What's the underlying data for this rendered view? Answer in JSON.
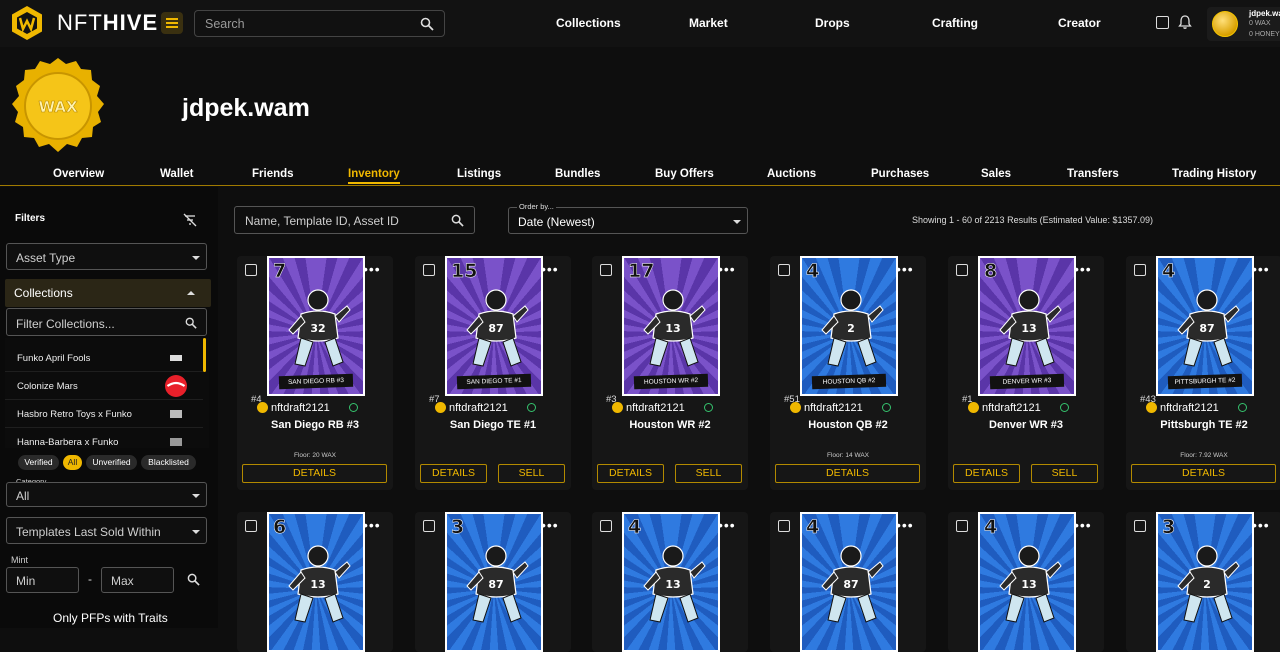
{
  "header": {
    "brand_light": "NFT",
    "brand_bold": "HIVE",
    "search_placeholder": "Search",
    "nav": [
      "Collections",
      "Market",
      "Drops",
      "Crafting",
      "Creator"
    ],
    "account": {
      "name": "jdpek.wam",
      "wax": "0 WAX",
      "honey": "0 HONEY"
    }
  },
  "profile": {
    "name": "jdpek.wam",
    "avatar_text": "WAX"
  },
  "tabs": [
    "Overview",
    "Wallet",
    "Friends",
    "Inventory",
    "Listings",
    "Bundles",
    "Buy Offers",
    "Auctions",
    "Purchases",
    "Sales",
    "Transfers",
    "Trading History"
  ],
  "active_tab": "Inventory",
  "sidebar": {
    "title": "Filters",
    "asset_type": "Asset Type",
    "collections_label": "Collections",
    "filter_collections_placeholder": "Filter Collections...",
    "collections": [
      "Funko April Fools",
      "Colonize Mars",
      "Hasbro Retro Toys x Funko",
      "Hanna-Barbera x Funko"
    ],
    "chips": [
      "Verified",
      "All",
      "Unverified",
      "Blacklisted"
    ],
    "category_label": "Category",
    "category_value": "All",
    "templates_sold": "Templates Last Sold Within",
    "mint_label": "Mint",
    "mint_min": "Min",
    "mint_max": "Max",
    "pfp": "Only PFPs with Traits"
  },
  "main": {
    "search_placeholder": "Name, Template ID, Asset ID",
    "order_label": "Order by...",
    "order_value": "Date (Newest)",
    "showing": "Showing 1 - 60 of 2213 Results (Estimated Value: $1357.09)"
  },
  "labels": {
    "details": "DETAILS",
    "sell": "SELL"
  },
  "cards": [
    {
      "num": "7",
      "mint": "#4",
      "collection": "nftdraft2121",
      "title": "San Diego RB #3",
      "banner": "SAN DIEGO RB #3",
      "floor": "Floor: 20 WAX",
      "color": "purple",
      "jersey": "32",
      "sell": false
    },
    {
      "num": "15",
      "mint": "#7",
      "collection": "nftdraft2121",
      "title": "San Diego TE #1",
      "banner": "SAN DIEGO TE #1",
      "floor": "",
      "color": "purple",
      "jersey": "87",
      "sell": true
    },
    {
      "num": "17",
      "mint": "#3",
      "collection": "nftdraft2121",
      "title": "Houston WR #2",
      "banner": "HOUSTON WR #2",
      "floor": "",
      "color": "purple",
      "jersey": "13",
      "sell": true
    },
    {
      "num": "4",
      "mint": "#51",
      "collection": "nftdraft2121",
      "title": "Houston QB #2",
      "banner": "HOUSTON QB #2",
      "floor": "Floor: 14 WAX",
      "color": "blue",
      "jersey": "2",
      "sell": false
    },
    {
      "num": "8",
      "mint": "#1",
      "collection": "nftdraft2121",
      "title": "Denver WR #3",
      "banner": "DENVER WR #3",
      "floor": "",
      "color": "purple",
      "jersey": "13",
      "sell": true
    },
    {
      "num": "4",
      "mint": "#43",
      "collection": "nftdraft2121",
      "title": "Pittsburgh TE #2",
      "banner": "PITTSBURGH TE #2",
      "floor": "Floor: 7.92 WAX",
      "color": "blue",
      "jersey": "87",
      "sell": false
    },
    {
      "num": "6",
      "color": "blue",
      "jersey": "13"
    },
    {
      "num": "3",
      "color": "blue",
      "jersey": "87"
    },
    {
      "num": "4",
      "color": "blue",
      "jersey": "13"
    },
    {
      "num": "4",
      "color": "blue",
      "jersey": "87"
    },
    {
      "num": "4",
      "color": "blue",
      "jersey": "13"
    },
    {
      "num": "3",
      "color": "blue",
      "jersey": "2"
    }
  ]
}
